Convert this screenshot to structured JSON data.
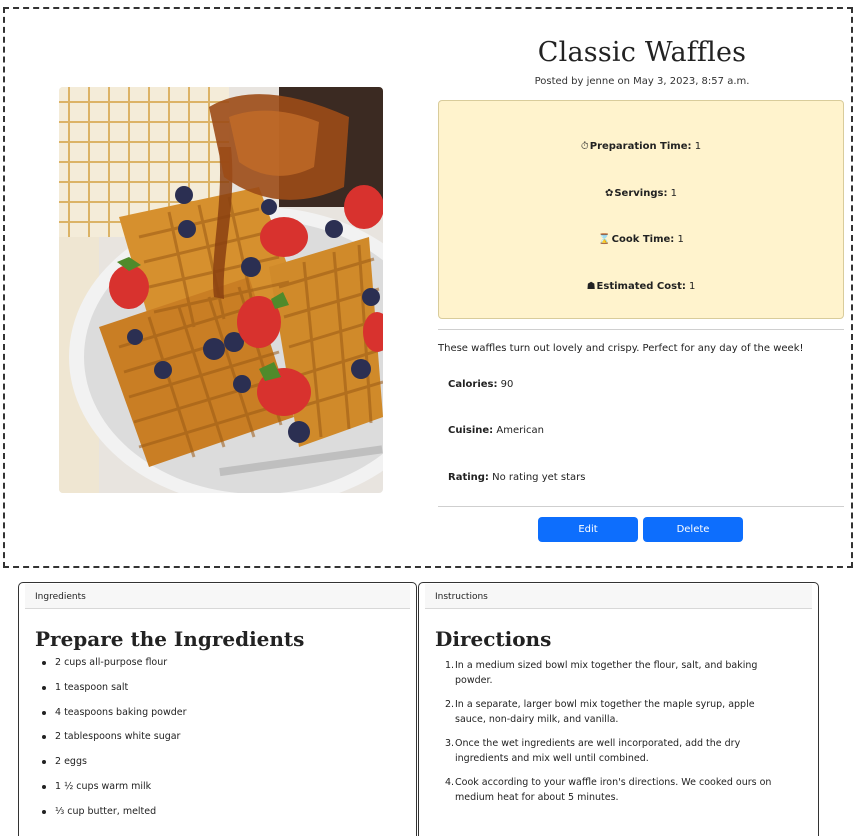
{
  "recipe": {
    "title": "Classic Waffles",
    "posted": "Posted by jenne on May 3, 2023, 8:57 a.m.",
    "photo_alt": "Waffles with berries and syrup",
    "stats": [
      {
        "icon": "stopwatch-icon",
        "glyph": "⏱",
        "label": "Preparation Time:",
        "value": "1"
      },
      {
        "icon": "servings-icon",
        "glyph": "✿",
        "label": "Servings:",
        "value": "1"
      },
      {
        "icon": "hourglass-icon",
        "glyph": "⌛",
        "label": "Cook Time:",
        "value": "1"
      },
      {
        "icon": "cost-tag-icon",
        "glyph": "☗",
        "label": "Estimated Cost:",
        "value": "1"
      }
    ],
    "description": "These waffles turn out lovely and crispy. Perfect for any day of the week!",
    "meta": [
      {
        "label": "Calories:",
        "value": "90"
      },
      {
        "label": "Cuisine:",
        "value": "American"
      },
      {
        "label": "Rating:",
        "value": "No rating yet stars"
      }
    ],
    "edit_label": "Edit",
    "delete_label": "Delete"
  },
  "ingredients_card": {
    "header": "Ingredients",
    "title": "Prepare the Ingredients",
    "items": [
      "2 cups all-purpose flour",
      "1 teaspoon salt",
      "4 teaspoons baking powder",
      "2 tablespoons white sugar",
      "2 eggs",
      "1 ½ cups warm milk",
      "⅓ cup butter, melted"
    ]
  },
  "instructions_card": {
    "header": "Instructions",
    "title": "Directions",
    "steps": [
      {
        "num": "1.",
        "text": "In a medium sized bowl mix together the flour, salt, and baking powder."
      },
      {
        "num": "2.",
        "text": "In a separate, larger bowl mix together the maple syrup, apple sauce, non-dairy milk, and vanilla."
      },
      {
        "num": "3.",
        "text": "Once the wet ingredients are well incorporated, add the dry ingredients and mix well until combined."
      },
      {
        "num": "4.",
        "text": "Cook according to your waffle iron's directions. We cooked ours on medium heat for about 5 minutes."
      }
    ]
  },
  "colors": {
    "primary_button": "#0d6efd",
    "stats_background": "#fff3cd"
  }
}
